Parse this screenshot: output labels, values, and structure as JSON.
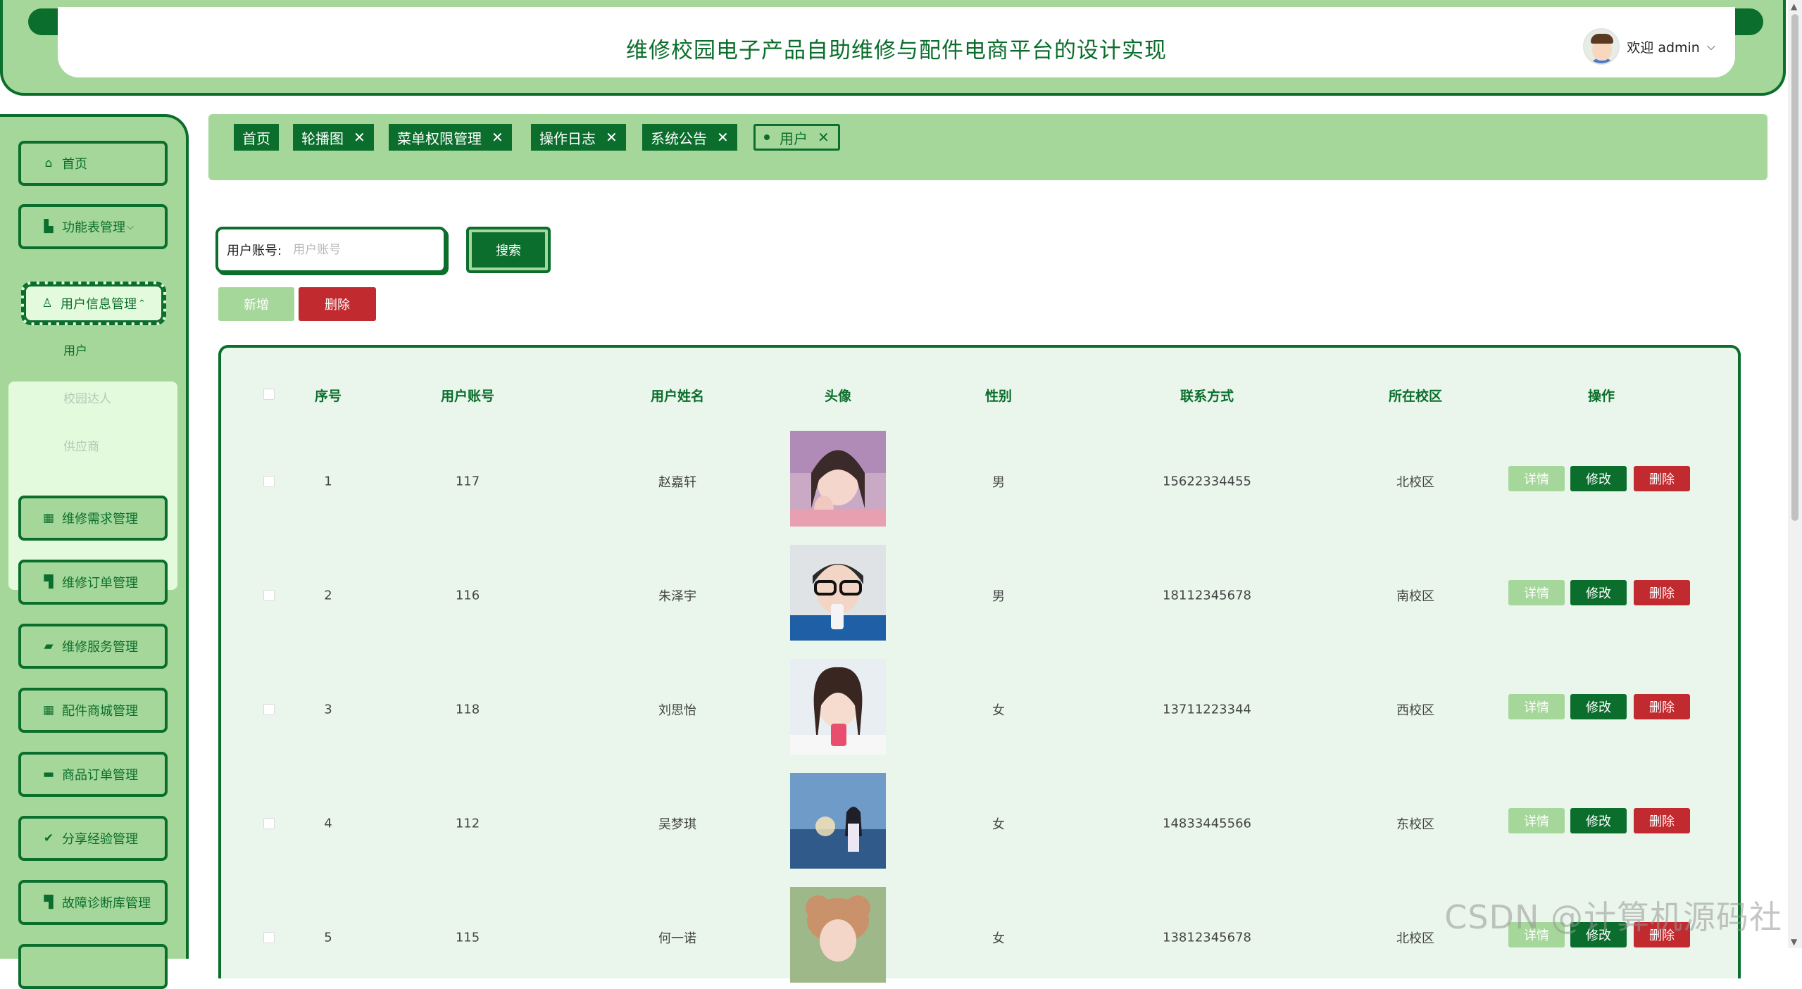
{
  "header": {
    "title": "维修校园电子产品自助维修与配件电商平台的设计实现",
    "welcome": "欢迎 admin"
  },
  "sidebar": {
    "items": [
      {
        "label": "首页",
        "icon": "home-icon"
      },
      {
        "label": "功能表管理",
        "icon": "building-icon"
      },
      {
        "label": "用户信息管理",
        "icon": "user-icon"
      },
      {
        "label": "维修需求管理",
        "icon": "grid-icon"
      },
      {
        "label": "维修订单管理",
        "icon": "cart-icon"
      },
      {
        "label": "维修服务管理",
        "icon": "folder-icon"
      },
      {
        "label": "配件商城管理",
        "icon": "grid-icon"
      },
      {
        "label": "商品订单管理",
        "icon": "list-icon"
      },
      {
        "label": "分享经验管理",
        "icon": "check-circle-icon"
      },
      {
        "label": "故障诊断库管理",
        "icon": "cart-icon"
      }
    ],
    "submenu": [
      "用户",
      "校园达人",
      "供应商"
    ]
  },
  "tabs": [
    {
      "label": "首页"
    },
    {
      "label": "轮播图"
    },
    {
      "label": "菜单权限管理"
    },
    {
      "label": "操作日志"
    },
    {
      "label": "系统公告"
    },
    {
      "label": "用户"
    }
  ],
  "search": {
    "label": "用户账号:",
    "placeholder": "用户账号",
    "button": "搜索"
  },
  "toolbar": {
    "add": "新增",
    "delete": "删除"
  },
  "table": {
    "headers": [
      "序号",
      "用户账号",
      "用户姓名",
      "头像",
      "性别",
      "联系方式",
      "所在校区",
      "操作"
    ],
    "actions": {
      "detail": "详情",
      "edit": "修改",
      "remove": "删除"
    },
    "rows": [
      {
        "no": "1",
        "account": "117",
        "name": "赵嘉轩",
        "gender": "男",
        "phone": "15622334455",
        "campus": "北校区"
      },
      {
        "no": "2",
        "account": "116",
        "name": "朱泽宇",
        "gender": "男",
        "phone": "18112345678",
        "campus": "南校区"
      },
      {
        "no": "3",
        "account": "118",
        "name": "刘思怡",
        "gender": "女",
        "phone": "13711223344",
        "campus": "西校区"
      },
      {
        "no": "4",
        "account": "112",
        "name": "吴梦琪",
        "gender": "女",
        "phone": "14833445566",
        "campus": "东校区"
      },
      {
        "no": "5",
        "account": "115",
        "name": "何一诺",
        "gender": "女",
        "phone": "13812345678",
        "campus": "北校区"
      }
    ]
  },
  "watermark": "CSDN @计算机源码社",
  "colors": {
    "primary": "#0b6e2c",
    "light": "#a5d79a",
    "danger": "#c12a2f",
    "table_bg": "#eaf6ec"
  }
}
